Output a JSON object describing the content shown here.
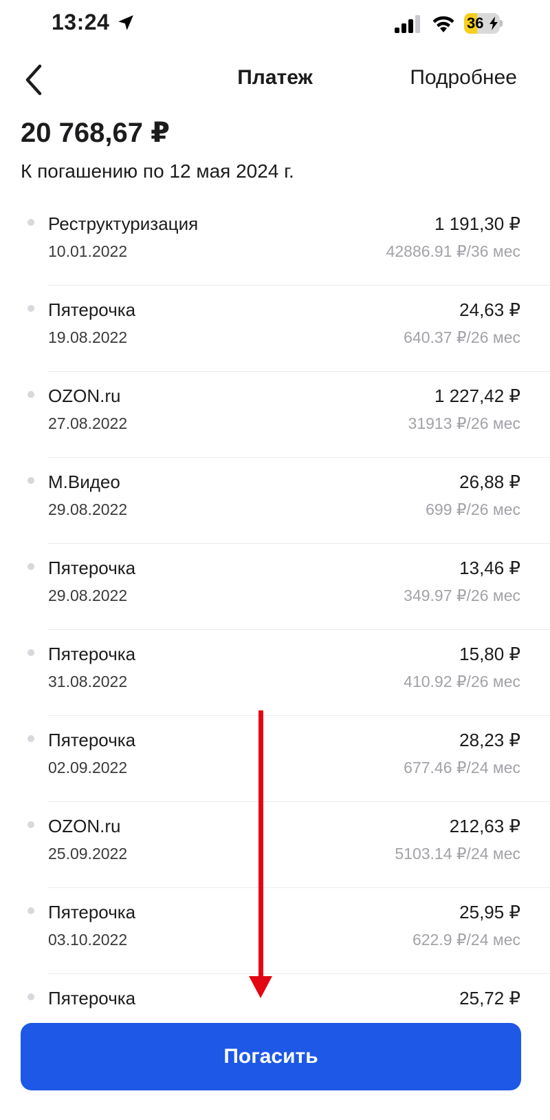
{
  "status_bar": {
    "time": "13:24",
    "battery": "36",
    "battery_level": 0.36
  },
  "nav": {
    "title": "Платеж",
    "more_label": "Подробнее"
  },
  "summary": {
    "amount": "20 768,67 ₽",
    "due_text": "К погашению по 12 мая 2024 г."
  },
  "payments": [
    {
      "name": "Реструктуризация",
      "date": "10.01.2022",
      "sum": "1 191,30 ₽",
      "plan": "42886.91 ₽/36 мес"
    },
    {
      "name": "Пятерочка",
      "date": "19.08.2022",
      "sum": "24,63 ₽",
      "plan": "640.37 ₽/26 мес"
    },
    {
      "name": "OZON.ru",
      "date": "27.08.2022",
      "sum": "1 227,42 ₽",
      "plan": "31913 ₽/26 мес"
    },
    {
      "name": "М.Видео",
      "date": "29.08.2022",
      "sum": "26,88 ₽",
      "plan": "699 ₽/26 мес"
    },
    {
      "name": "Пятерочка",
      "date": "29.08.2022",
      "sum": "13,46 ₽",
      "plan": "349.97 ₽/26 мес"
    },
    {
      "name": "Пятерочка",
      "date": "31.08.2022",
      "sum": "15,80 ₽",
      "plan": "410.92 ₽/26 мес"
    },
    {
      "name": "Пятерочка",
      "date": "02.09.2022",
      "sum": "28,23 ₽",
      "plan": "677.46 ₽/24 мес"
    },
    {
      "name": "OZON.ru",
      "date": "25.09.2022",
      "sum": "212,63 ₽",
      "plan": "5103.14 ₽/24 мес"
    },
    {
      "name": "Пятерочка",
      "date": "03.10.2022",
      "sum": "25,95 ₽",
      "plan": "622.9 ₽/24 мес"
    },
    {
      "name": "Пятерочка",
      "date": "",
      "sum": "25,72 ₽",
      "plan": ""
    }
  ],
  "pay_button": {
    "label": "Погасить"
  },
  "colors": {
    "accent": "#1d58e6",
    "annotation": "#e30613",
    "muted": "#a2a2a8",
    "battery": "#f7cf1e"
  },
  "icons": {
    "back": "chevron-left-icon",
    "location": "location-arrow-icon",
    "signal": "cellular-signal-icon",
    "wifi": "wifi-icon",
    "charging": "bolt-icon"
  }
}
